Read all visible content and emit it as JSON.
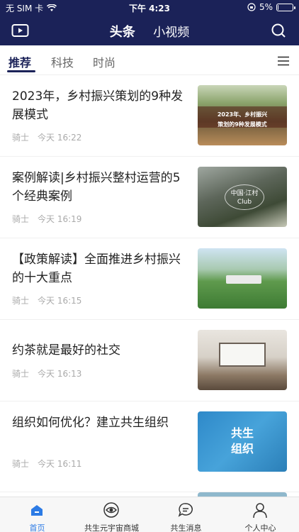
{
  "status_bar": {
    "carrier": "无 SIM 卡",
    "time": "下午 4:23",
    "battery_text": "5%",
    "battery_level": 0.05
  },
  "nav": {
    "tabs": [
      {
        "label": "头条",
        "active": true
      },
      {
        "label": "小视频",
        "active": false
      }
    ],
    "video_icon": "video-camera-icon",
    "search_icon": "search-icon"
  },
  "categories": {
    "items": [
      {
        "label": "推荐",
        "active": true
      },
      {
        "label": "科技",
        "active": false
      },
      {
        "label": "时尚",
        "active": false
      }
    ],
    "menu_icon": "menu-icon"
  },
  "articles": [
    {
      "title": "2023年，乡村振兴策划的9种发展模式",
      "author": "骑士",
      "time": "今天 16:22",
      "thumb_text": [
        "2023年、乡村振兴",
        "策划的9种发展模式"
      ]
    },
    {
      "title": "案例解读|乡村振兴整村运营的5个经典案例",
      "author": "骑士",
      "time": "今天 16:19",
      "thumb_text": [
        "中国·江村",
        "Club"
      ]
    },
    {
      "title": "【政策解读】全面推进乡村振兴的十大重点",
      "author": "骑士",
      "time": "今天 16:15"
    },
    {
      "title": "约茶就是最好的社交",
      "author": "骑士",
      "time": "今天 16:13"
    },
    {
      "title": "组织如何优化？建立共生组织",
      "author": "骑士",
      "time": "今天 16:11",
      "thumb_text": [
        "共生",
        "组织"
      ]
    }
  ],
  "tabbar": {
    "items": [
      {
        "label": "首页",
        "icon": "home-icon",
        "active": true
      },
      {
        "label": "共生元宇宙商城",
        "icon": "eye-icon",
        "active": false
      },
      {
        "label": "共生消息",
        "icon": "chat-bubble-icon",
        "active": false
      },
      {
        "label": "个人中心",
        "icon": "person-icon",
        "active": false
      }
    ]
  },
  "colors": {
    "header_bg": "#1b2258",
    "tab_active": "#2c7be5",
    "meta_text": "#aaaaaa"
  }
}
